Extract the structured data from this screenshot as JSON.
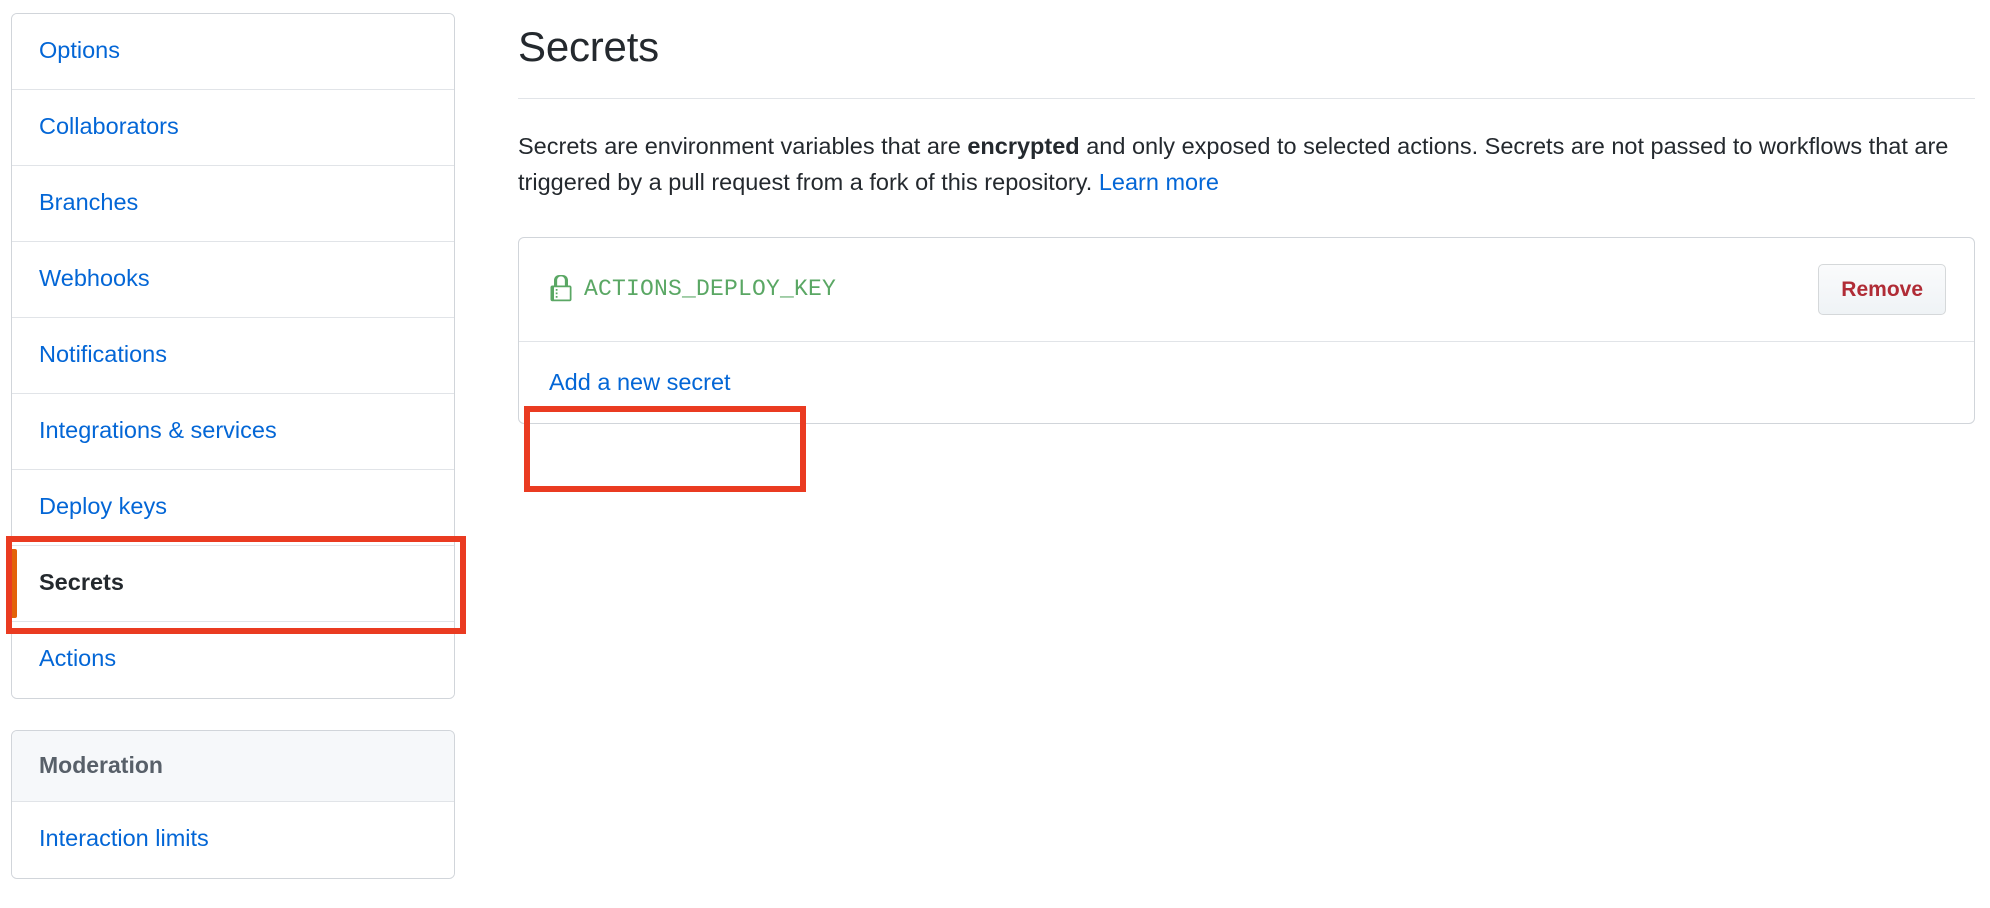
{
  "sidebar": {
    "groups": [
      {
        "heading": null,
        "items": [
          {
            "label": "Options",
            "selected": false
          },
          {
            "label": "Collaborators",
            "selected": false
          },
          {
            "label": "Branches",
            "selected": false
          },
          {
            "label": "Webhooks",
            "selected": false
          },
          {
            "label": "Notifications",
            "selected": false
          },
          {
            "label": "Integrations & services",
            "selected": false
          },
          {
            "label": "Deploy keys",
            "selected": false
          },
          {
            "label": "Secrets",
            "selected": true
          },
          {
            "label": "Actions",
            "selected": false
          }
        ]
      },
      {
        "heading": "Moderation",
        "items": [
          {
            "label": "Interaction limits",
            "selected": false
          }
        ]
      }
    ]
  },
  "main": {
    "title": "Secrets",
    "description": {
      "part1": "Secrets are environment variables that are ",
      "emphasis": "encrypted",
      "part2": " and only exposed to selected actions. Secrets are not passed to workflows that are triggered by a pull request from a fork of this repository. ",
      "learn_more": "Learn more"
    },
    "secrets": [
      {
        "icon": "lock-icon",
        "name": "ACTIONS_DEPLOY_KEY",
        "remove_label": "Remove"
      }
    ],
    "add_secret_label": "Add a new secret"
  },
  "colors": {
    "link": "#0366d6",
    "secret_green": "#5aa764",
    "remove_red": "#b02c36",
    "selected_marker": "#e36209",
    "annotation_red": "#ea3b21",
    "border": "#d1d5da",
    "text": "#24292e",
    "muted_text": "#586069",
    "heading_bg": "#f6f8fa"
  },
  "annotations": [
    {
      "name": "sidebar-item-secrets",
      "target": "Secrets"
    },
    {
      "name": "add-a-new-secret-link",
      "target": "Add a new secret"
    }
  ]
}
